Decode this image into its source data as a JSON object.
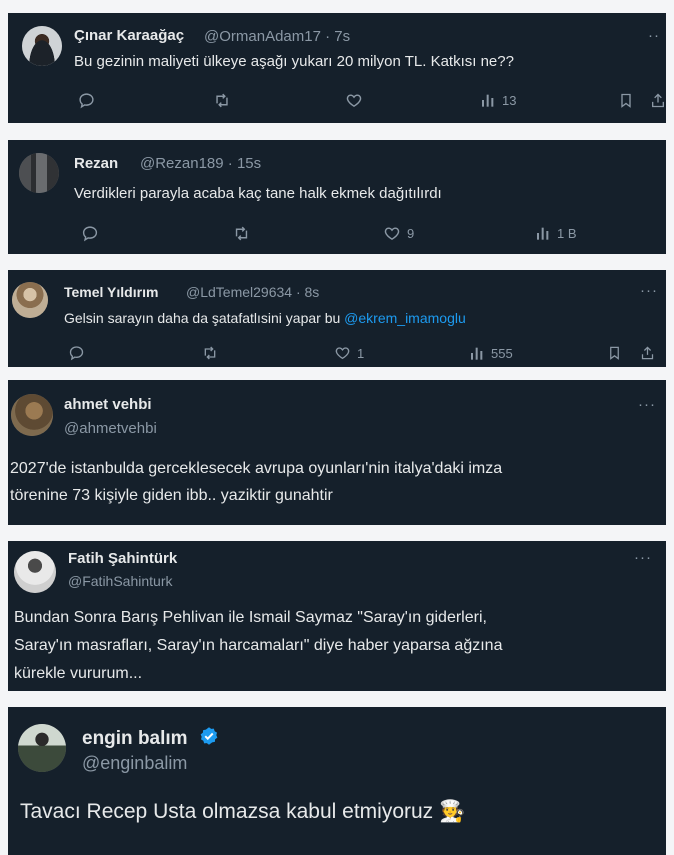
{
  "colors": {
    "card_bg": "#15202b",
    "text": "#e7e9ea",
    "muted": "#8b98a5",
    "link": "#1d9bf0"
  },
  "tweets": [
    {
      "name": "Çınar Karaağaç",
      "meta": "@OrmanAdam17 · 7s",
      "text": "Bu gezinin maliyeti ülkeye aşağı yukarı 20 milyon TL. Katkısı ne??",
      "more": "··",
      "views": "13"
    },
    {
      "name": "Rezan",
      "meta": "@Rezan189 · 15s",
      "text": "Verdikleri parayla acaba kaç tane halk ekmek dağıtılırdı",
      "likes": "9",
      "views": "1 B"
    },
    {
      "name": "Temel Yıldırım",
      "meta": "@LdTemel29634 · 8s",
      "text": "Gelsin sarayın daha da şatafatlısini yapar bu",
      "mention": "@ekrem_imamoglu",
      "more": "···",
      "likes": "1",
      "views": "555"
    },
    {
      "name": "ahmet vehbi",
      "handle": "@ahmetvehbi",
      "more": "···",
      "lines": [
        "2027'de istanbulda gerceklesecek avrupa oyunları'nin italya'daki imza",
        "törenine 73 kişiyle giden ibb.. yaziktir gunahtir"
      ]
    },
    {
      "name": "Fatih Şahintürk",
      "handle": "@FatihSahinturk",
      "more": "···",
      "lines": [
        "Bundan Sonra Barış Pehlivan ile Ismail Saymaz \"Saray'ın giderleri,",
        "Saray'ın masrafları, Saray'ın harcamaları\" diye haber yaparsa ağzına",
        "kürekle vururum..."
      ]
    },
    {
      "name": "engin balım",
      "handle": "@enginbalim",
      "text": "Tavacı Recep Usta olmazsa kabul etmiyoruz",
      "emoji": "🧑‍🍳"
    }
  ]
}
